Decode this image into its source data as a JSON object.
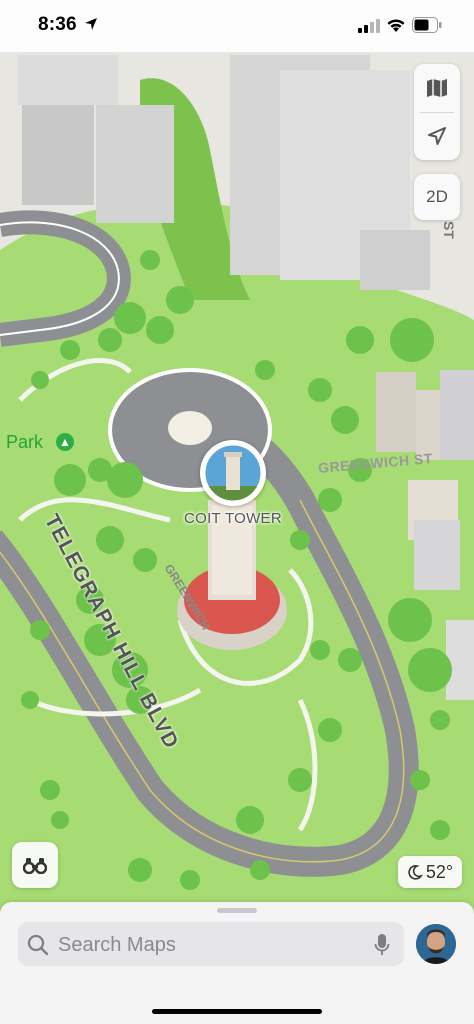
{
  "status_bar": {
    "time": "8:36",
    "icons": [
      "location-arrow-icon",
      "cellular-signal-icon",
      "wifi-icon",
      "battery-icon"
    ]
  },
  "map": {
    "poi": {
      "name": "COIT TOWER",
      "icon": "tower-photo"
    },
    "park_label": "Park",
    "streets": {
      "telegraph": "TELEGRAPH HILL BLVD",
      "greenwich": "GREENWICH ST",
      "greenwich_curve": "GREENWICH",
      "st": "ST"
    },
    "colors": {
      "park": "#a6dc73",
      "road": "#8d8f93",
      "building": "#d6d6d6",
      "tower_base": "#d9574f"
    }
  },
  "controls": {
    "map_mode_icon": "map-icon",
    "location_icon": "navigation-arrow-icon",
    "view_toggle_label": "2D",
    "look_around_icon": "binoculars-icon"
  },
  "weather": {
    "icon": "moon-icon",
    "temperature": "52°"
  },
  "search": {
    "placeholder": "Search Maps",
    "icon": "magnifying-glass-icon",
    "mic_icon": "microphone-icon"
  },
  "profile": {
    "icon": "avatar"
  }
}
